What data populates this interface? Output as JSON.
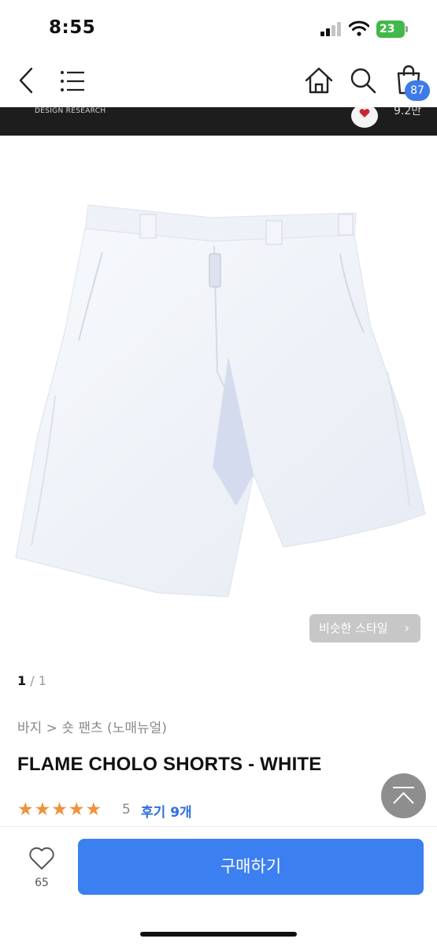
{
  "status_bar": {
    "time": "8:55",
    "battery_level": "23",
    "icons": [
      "cellular-signal-icon",
      "wifi-icon",
      "battery-charging-icon"
    ],
    "battery_color": "#43b84a"
  },
  "nav": {
    "icons": [
      "back-icon",
      "menu-icon",
      "home-icon",
      "search-icon",
      "cart-icon"
    ],
    "cart_count": "87",
    "badge_color": "#3c7be8"
  },
  "brand_strip": {
    "subtitle": "DESIGN RESEARCH",
    "like_count": "9.2만"
  },
  "product": {
    "similar_style_label": "비슷한 스타일",
    "pager": {
      "current": "1",
      "separator": " / ",
      "total": "1"
    },
    "breadcrumb": "바지 > 숏 팬츠 (노매뉴얼)",
    "title": "FLAME CHOLO SHORTS - WHITE",
    "stars": "★★★★★",
    "rating": "5",
    "rating_value": 5,
    "rating_max": 5,
    "review_link": "후기 9개",
    "star_color": "#f0923c",
    "link_color": "#2f6fde"
  },
  "bottom_bar": {
    "like_count": "65",
    "buy_label": "구매하기",
    "buy_color": "#3c7ff0"
  }
}
